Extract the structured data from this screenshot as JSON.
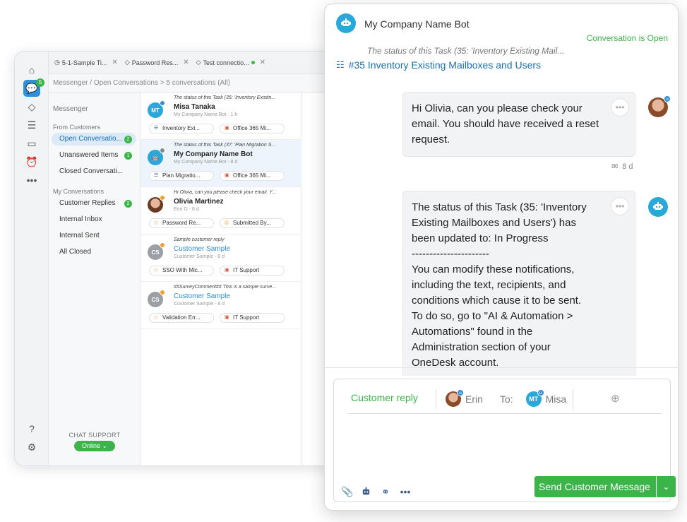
{
  "sidebar": {
    "messenger_badge": "5"
  },
  "tabs": [
    {
      "label": "5-1-Sample Ti..."
    },
    {
      "label": "Password Res..."
    },
    {
      "label": "Test connectio..."
    }
  ],
  "breadcrumb": {
    "root": "Messenger",
    "section": "Open Conversations",
    "count": "5 conversations (All)"
  },
  "nav": {
    "header": "Messenger",
    "from_customers": "From Customers",
    "items_customers": [
      {
        "label": "Open Conversatio...",
        "count": "2"
      },
      {
        "label": "Unanswered Items",
        "count": "1"
      },
      {
        "label": "Closed Conversati..."
      }
    ],
    "my_conversations": "My Conversations",
    "items_mine": [
      {
        "label": "Customer Replies",
        "count": "2"
      },
      {
        "label": "Internal Inbox"
      },
      {
        "label": "Internal Sent"
      },
      {
        "label": "All Closed"
      }
    ],
    "chat_support": "CHAT SUPPORT",
    "online": "Online"
  },
  "conversations": [
    {
      "snippet": "The status of this Task (35: 'Inventory Existin...",
      "name": "Misa Tanaka",
      "initials": "MT",
      "meta": "My Company Name Bot - 1 h",
      "chip1": "Inventory Exi...",
      "chip2": "Office 365 Mi..."
    },
    {
      "snippet": "The status of this Task (37: 'Plan Migration S...",
      "name": "My Company Name Bot",
      "meta": "My Company Name Bot - 8 d",
      "chip1": "Plan Migratio...",
      "chip2": "Office 365 Mi..."
    },
    {
      "snippet": "Hi Olivia, can you please check your email. Y...",
      "name": "Olivia  Martinez",
      "meta": "Erin G - 8 d",
      "chip1": "Password Re...",
      "chip2": "Submitted By..."
    },
    {
      "snippet": "Sample customer reply",
      "name": "Customer Sample",
      "initials": "CS",
      "meta": "Customer Sample - 8 d",
      "chip1": "SSO With Mic...",
      "chip2": "IT Support"
    },
    {
      "snippet": "##SurveyComment## This is a sample surve...",
      "name": "Customer Sample",
      "initials": "CS",
      "meta": "Customer Sample - 8 d",
      "chip1": "Validation Err...",
      "chip2": "IT Support"
    }
  ],
  "panel": {
    "bot_name": "My Company Name Bot",
    "status": "Conversation is Open",
    "status_snippet": "The status of this Task (35: 'Inventory Existing Mail...",
    "task_link": "#35 Inventory Existing Mailboxes and Users",
    "msg1": "Hi Olivia, can you please check your email. You should have received a reset request.",
    "msg1_time": "8 d",
    "msg2_lines": [
      "The status of this Task (35: 'Inventory",
      "Existing Mailboxes and Users') has",
      "been updated to: In Progress",
      "----------------------",
      "You can modify these notifications,",
      "including the text, recipients, and",
      "conditions which cause it to be sent.",
      "To do so, go to \"AI & Automation >",
      "Automations\" found in the",
      "Administration section of your",
      "OneDesk account."
    ]
  },
  "composer": {
    "mode": "Customer reply",
    "from": "Erin",
    "to_label": "To:",
    "to": "Misa",
    "to_initials": "MT",
    "send_label": "Send Customer Message"
  },
  "colors": {
    "accent_green": "#3bb54a",
    "accent_blue": "#2aa8d9",
    "link_blue": "#1b6fb5"
  }
}
